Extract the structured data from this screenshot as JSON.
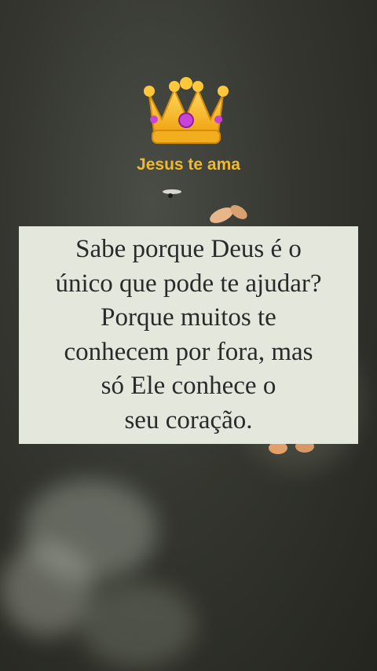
{
  "brand": {
    "icon": "crown-icon",
    "label": "Jesus te ama",
    "label_color": "#f2b928"
  },
  "quote": {
    "lines": [
      "Sabe porque Deus é o",
      "único que pode te ajudar?",
      "Porque muitos te",
      "conhecem por fora, mas",
      "só Ele conhece o",
      "seu coração."
    ]
  }
}
